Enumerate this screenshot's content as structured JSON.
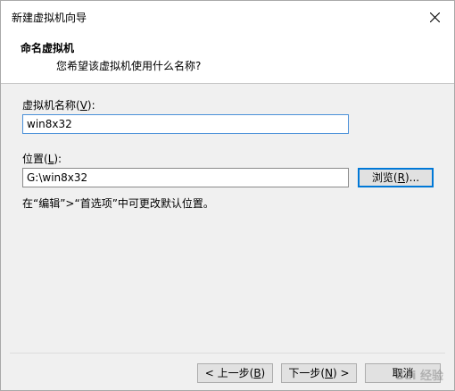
{
  "window": {
    "title": "新建虚拟机向导"
  },
  "header": {
    "title": "命名虚拟机",
    "subtitle": "您希望该虚拟机使用什么名称?"
  },
  "vm_name": {
    "label_prefix": "虚拟机名称(",
    "label_key": "V",
    "label_suffix": "):",
    "value": "win8x32"
  },
  "location": {
    "label_prefix": "位置(",
    "label_key": "L",
    "label_suffix": "):",
    "value": "G:\\win8x32"
  },
  "browse_button": {
    "label_prefix": "浏览(",
    "label_key": "R",
    "label_suffix": ")..."
  },
  "hint": "在“编辑”>“首选项”中可更改默认位置。",
  "footer": {
    "back_prefix": "< 上一步(",
    "back_key": "B",
    "back_suffix": ")",
    "next_prefix": "下一步(",
    "next_key": "N",
    "next_suffix": ") >",
    "cancel": "取消"
  },
  "watermark": "Bai 经验"
}
